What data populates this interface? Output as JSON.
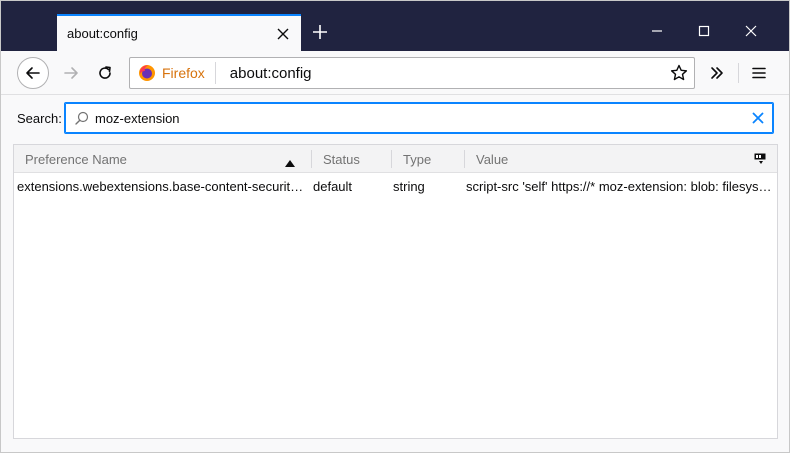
{
  "tab": {
    "title": "about:config",
    "new_tab_label": "+"
  },
  "urlbar": {
    "identity_label": "Firefox",
    "url": "about:config"
  },
  "search": {
    "label": "Search:",
    "value": "moz-extension"
  },
  "table": {
    "columns": [
      "Preference Name",
      "Status",
      "Type",
      "Value"
    ],
    "rows": [
      {
        "name": "extensions.webextensions.base-content-security…",
        "status": "default",
        "type": "string",
        "value": "script-src 'self' https://* moz-extension: blob: filesys…"
      }
    ]
  },
  "colors": {
    "titlebar": "#202340",
    "accent": "#0a84ff",
    "firefox_orange": "#d7730d"
  }
}
